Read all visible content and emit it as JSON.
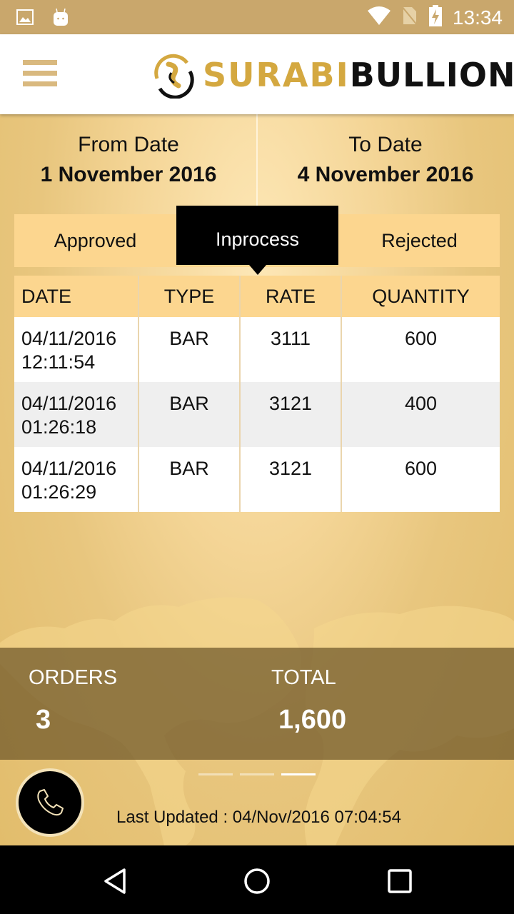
{
  "status_bar": {
    "time": "13:34",
    "icons": [
      "image-notification-icon",
      "android-notification-icon",
      "wifi-icon",
      "no-sim-icon",
      "battery-charging-icon"
    ]
  },
  "app_bar": {
    "menu_icon": "hamburger-menu-icon",
    "logo": {
      "part1": "SURABI",
      "part2": "BULLION"
    }
  },
  "dates": {
    "from": {
      "label": "From Date",
      "value": "1 November 2016"
    },
    "to": {
      "label": "To Date",
      "value": "4 November 2016"
    }
  },
  "tabs": [
    {
      "label": "Approved",
      "active": false
    },
    {
      "label": "Inprocess",
      "active": true
    },
    {
      "label": "Rejected",
      "active": false
    }
  ],
  "table": {
    "headers": [
      "DATE",
      "TYPE",
      "RATE",
      "QUANTITY"
    ],
    "rows": [
      {
        "date": "04/11/2016",
        "time": "12:11:54",
        "type": "BAR",
        "rate": "3111",
        "quantity": "600"
      },
      {
        "date": "04/11/2016",
        "time": "01:26:18",
        "type": "BAR",
        "rate": "3121",
        "quantity": "400"
      },
      {
        "date": "04/11/2016",
        "time": "01:26:29",
        "type": "BAR",
        "rate": "3121",
        "quantity": "600"
      }
    ]
  },
  "summary": {
    "orders_label": "ORDERS",
    "orders_value": "3",
    "total_label": "TOTAL",
    "total_value": "1,600"
  },
  "pager": {
    "pages": 3,
    "current": 3
  },
  "footer": {
    "call_icon": "phone-icon",
    "last_updated": "Last Updated :  04/Nov/2016 07:04:54"
  },
  "colors": {
    "status_bar": "#c9a76c",
    "tab_bg": "#fcd68f",
    "active_tab": "#000000",
    "summary_bg": "#6e5628",
    "logo_gold": "#d4a840"
  }
}
